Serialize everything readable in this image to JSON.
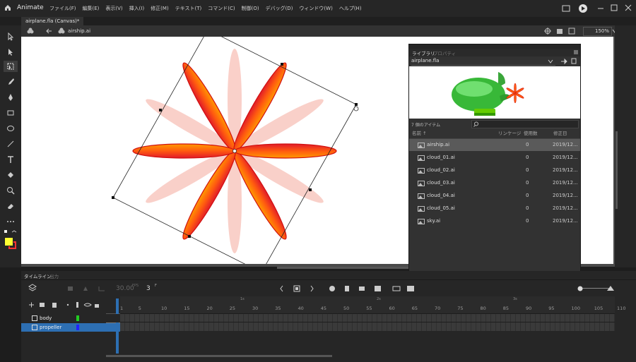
{
  "app": {
    "name": "Animate"
  },
  "menu": [
    "ファイル(F)",
    "編集(E)",
    "表示(V)",
    "挿入(I)",
    "修正(M)",
    "テキスト(T)",
    "コマンド(C)",
    "制御(O)",
    "デバッグ(D)",
    "ウィンドウ(W)",
    "ヘルプ(H)"
  ],
  "document_tab": "airplane.fla (Canvas)*",
  "breadcrumb": "airship.ai",
  "zoom": "150%",
  "library": {
    "tab_library": "ライブラリ",
    "tab_properties": "プロパティ",
    "file_select": "airplane.fla",
    "item_count": "7 個のアイテム",
    "search_placeholder": "",
    "columns": {
      "name": "名前 ↑",
      "linkage": "リンケージ",
      "use_count": "使用数",
      "modified": "修正日"
    },
    "items": [
      {
        "name": "airship.ai",
        "use_count": "0",
        "modified": "2019/12...",
        "selected": true
      },
      {
        "name": "cloud_01.ai",
        "use_count": "0",
        "modified": "2019/12..."
      },
      {
        "name": "cloud_02.ai",
        "use_count": "0",
        "modified": "2019/12..."
      },
      {
        "name": "cloud_03.ai",
        "use_count": "0",
        "modified": "2019/12..."
      },
      {
        "name": "cloud_04.ai",
        "use_count": "0",
        "modified": "2019/12..."
      },
      {
        "name": "cloud_05.ai",
        "use_count": "0",
        "modified": "2019/12..."
      },
      {
        "name": "sky.ai",
        "use_count": "0",
        "modified": "2019/12..."
      }
    ]
  },
  "timeline": {
    "tab_timeline": "タイムライン",
    "tab_output": "出力",
    "fps": "30.00",
    "fps_unit": "FPS",
    "current_frame": "3",
    "frame_unit": "F",
    "second_markers": [
      "1s",
      "2s",
      "3s"
    ],
    "frame_numbers": [
      "1",
      "5",
      "10",
      "15",
      "20",
      "25",
      "30",
      "35",
      "40",
      "45",
      "50",
      "55",
      "60",
      "65",
      "70",
      "75",
      "80",
      "85",
      "90",
      "95",
      "100",
      "105",
      "110"
    ],
    "layers": [
      {
        "name": "body",
        "color": "#22cc22",
        "selected": false
      },
      {
        "name": "propeller",
        "color": "#2222ff",
        "selected": true
      }
    ]
  },
  "colors": {
    "stroke": "#ffff33",
    "fill": "#ff3333",
    "accent": "#2d6fb3"
  }
}
